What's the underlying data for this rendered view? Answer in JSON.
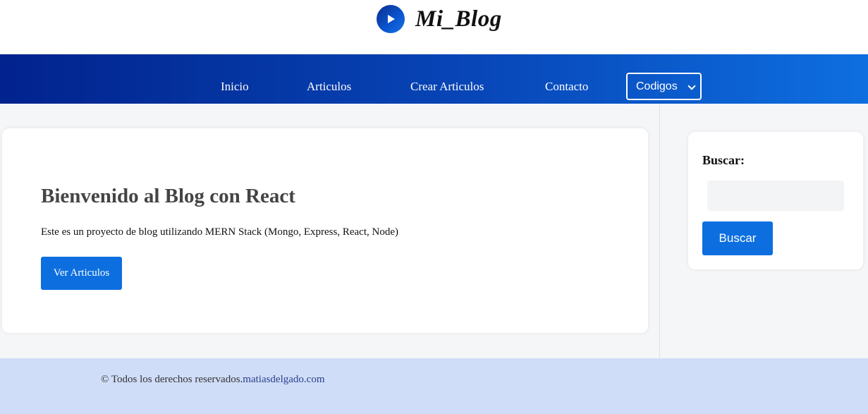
{
  "header": {
    "logo_icon": "play-icon",
    "logo_text": "Mi_Blog"
  },
  "nav": {
    "items": [
      "Inicio",
      "Articulos",
      "Crear Articulos",
      "Contacto"
    ],
    "select": {
      "selected": "Codigos"
    }
  },
  "main": {
    "title": "Bienvenido al Blog con React",
    "description": "Este es un proyecto de blog utilizando MERN Stack (Mongo, Express, React, Node)",
    "button_label": "Ver Articulos"
  },
  "sidebar": {
    "search_title": "Buscar:",
    "search_placeholder": "",
    "search_button": "Buscar"
  },
  "footer": {
    "text": "© Todos los derechos reservados.",
    "link": "matiasdelgado.com"
  },
  "colors": {
    "accent": "#0d6fdf",
    "nav_start": "#02228e",
    "nav_end": "#0e6fe0",
    "footer_bg": "#cfddf8"
  }
}
